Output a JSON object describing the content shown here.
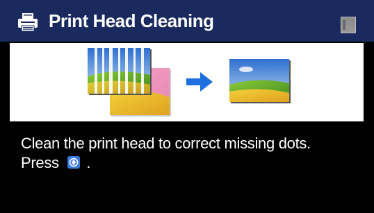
{
  "header": {
    "title": "Print Head Cleaning",
    "icon": "printer-icon",
    "status_icon": "ink-level-icon"
  },
  "illustration": {
    "before_image": "streaked-print-icon",
    "arrow": "right-arrow-icon",
    "after_image": "clean-print-icon"
  },
  "message": {
    "line1": "Clean the print head to correct missing dots.",
    "line2_prefix": "Press",
    "line2_icon": "start-button-icon",
    "line2_suffix": "."
  },
  "colors": {
    "title_bar": "#1a2a5e",
    "screen_background": "#000000",
    "panel_background": "#ffffff",
    "arrow": "#1e6fe0",
    "start_button": "#3a7be0"
  }
}
